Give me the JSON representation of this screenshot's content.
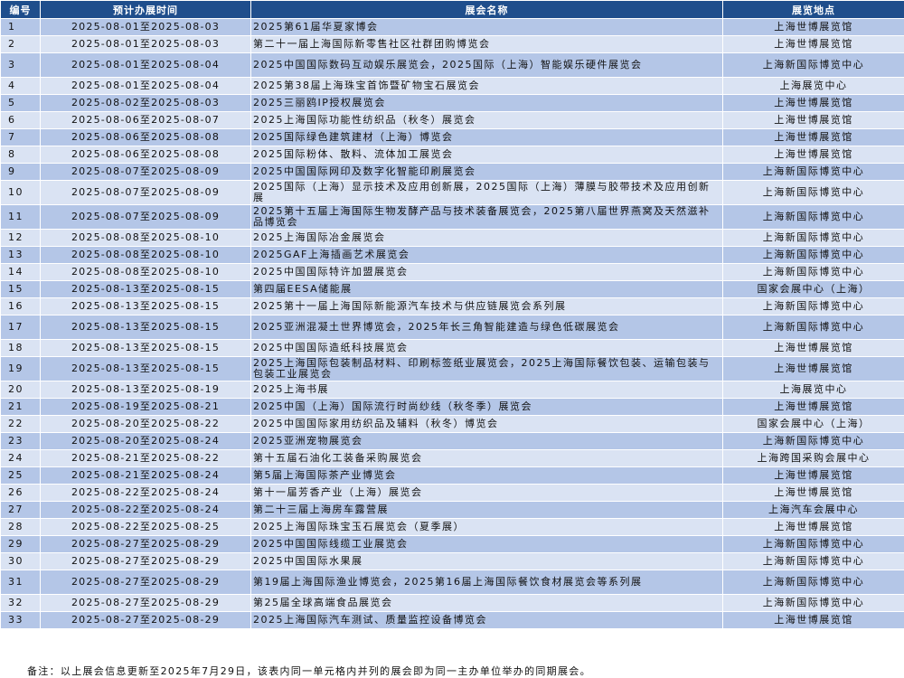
{
  "headers": {
    "no": "编号",
    "date": "预计办展时间",
    "name": "展会名称",
    "venue": "展览地点"
  },
  "rows": [
    {
      "no": "1",
      "date": "2025-08-01至2025-08-03",
      "name": "2025第61届华夏家博会",
      "venue": "上海世博展览馆"
    },
    {
      "no": "2",
      "date": "2025-08-01至2025-08-03",
      "name": "第二十一届上海国际新零售社区社群团购博览会",
      "venue": "上海世博展览馆"
    },
    {
      "no": "3",
      "date": "2025-08-01至2025-08-04",
      "name": "2025中国国际数码互动娱乐展览会，2025国际（上海）智能娱乐硬件展览会",
      "venue": "上海新国际博览中心"
    },
    {
      "no": "4",
      "date": "2025-08-01至2025-08-04",
      "name": "2025第38届上海珠宝首饰暨矿物宝石展览会",
      "venue": "上海展览中心"
    },
    {
      "no": "5",
      "date": "2025-08-02至2025-08-03",
      "name": "2025三丽鸥IP授权展览会",
      "venue": "上海世博展览馆"
    },
    {
      "no": "6",
      "date": "2025-08-06至2025-08-07",
      "name": "2025上海国际功能性纺织品（秋冬）展览会",
      "venue": "上海世博展览馆"
    },
    {
      "no": "7",
      "date": "2025-08-06至2025-08-08",
      "name": "2025国际绿色建筑建材（上海）博览会",
      "venue": "上海世博展览馆"
    },
    {
      "no": "8",
      "date": "2025-08-06至2025-08-08",
      "name": "2025国际粉体、散料、流体加工展览会",
      "venue": "上海世博展览馆"
    },
    {
      "no": "9",
      "date": "2025-08-07至2025-08-09",
      "name": "2025中国国际网印及数字化智能印刷展览会",
      "venue": "上海新国际博览中心"
    },
    {
      "no": "10",
      "date": "2025-08-07至2025-08-09",
      "name": "2025国际（上海）显示技术及应用创新展，2025国际（上海）薄膜与胶带技术及应用创新展",
      "venue": "上海新国际博览中心"
    },
    {
      "no": "11",
      "date": "2025-08-07至2025-08-09",
      "name": "2025第十五届上海国际生物发酵产品与技术装备展览会，2025第八届世界燕窝及天然滋补品博览会",
      "venue": "上海新国际博览中心"
    },
    {
      "no": "12",
      "date": "2025-08-08至2025-08-10",
      "name": "2025上海国际冶金展览会",
      "venue": "上海新国际博览中心"
    },
    {
      "no": "13",
      "date": "2025-08-08至2025-08-10",
      "name": "2025GAF上海插画艺术展览会",
      "venue": "上海新国际博览中心"
    },
    {
      "no": "14",
      "date": "2025-08-08至2025-08-10",
      "name": "2025中国国际特许加盟展览会",
      "venue": "上海新国际博览中心"
    },
    {
      "no": "15",
      "date": "2025-08-13至2025-08-15",
      "name": "第四届EESA储能展",
      "venue": "国家会展中心（上海）"
    },
    {
      "no": "16",
      "date": "2025-08-13至2025-08-15",
      "name": "2025第十一届上海国际新能源汽车技术与供应链展览会系列展",
      "venue": "上海新国际博览中心"
    },
    {
      "no": "17",
      "date": "2025-08-13至2025-08-15",
      "name": "2025亚洲混凝土世界博览会，2025年长三角智能建造与绿色低碳展览会",
      "venue": "上海新国际博览中心"
    },
    {
      "no": "18",
      "date": "2025-08-13至2025-08-15",
      "name": "2025中国国际造纸科技展览会",
      "venue": "上海世博展览馆"
    },
    {
      "no": "19",
      "date": "2025-08-13至2025-08-15",
      "name": "2025上海国际包装制品材料、印刷标签纸业展览会，2025上海国际餐饮包装、运输包装与包装工业展览会",
      "venue": "上海世博展览馆"
    },
    {
      "no": "20",
      "date": "2025-08-13至2025-08-19",
      "name": "2025上海书展",
      "venue": "上海展览中心"
    },
    {
      "no": "21",
      "date": "2025-08-19至2025-08-21",
      "name": "2025中国（上海）国际流行时尚纱线（秋冬季）展览会",
      "venue": "上海世博展览馆"
    },
    {
      "no": "22",
      "date": "2025-08-20至2025-08-22",
      "name": "2025中国国际家用纺织品及辅料（秋冬）博览会",
      "venue": "国家会展中心（上海）"
    },
    {
      "no": "23",
      "date": "2025-08-20至2025-08-24",
      "name": "2025亚洲宠物展览会",
      "venue": "上海新国际博览中心"
    },
    {
      "no": "24",
      "date": "2025-08-21至2025-08-22",
      "name": "第十五届石油化工装备采购展览会",
      "venue": "上海跨国采购会展中心"
    },
    {
      "no": "25",
      "date": "2025-08-21至2025-08-24",
      "name": "第5届上海国际茶产业博览会",
      "venue": "上海世博展览馆"
    },
    {
      "no": "26",
      "date": "2025-08-22至2025-08-24",
      "name": "第十一届芳香产业（上海）展览会",
      "venue": "上海世博展览馆"
    },
    {
      "no": "27",
      "date": "2025-08-22至2025-08-24",
      "name": "第二十三届上海房车露营展",
      "venue": "上海汽车会展中心"
    },
    {
      "no": "28",
      "date": "2025-08-22至2025-08-25",
      "name": "2025上海国际珠宝玉石展览会（夏季展）",
      "venue": "上海世博展览馆"
    },
    {
      "no": "29",
      "date": "2025-08-27至2025-08-29",
      "name": "2025中国国际线缆工业展览会",
      "venue": "上海新国际博览中心"
    },
    {
      "no": "30",
      "date": "2025-08-27至2025-08-29",
      "name": "2025中国国际水果展",
      "venue": "上海新国际博览中心"
    },
    {
      "no": "31",
      "date": "2025-08-27至2025-08-29",
      "name": "第19届上海国际渔业博览会，2025第16届上海国际餐饮食材展览会等系列展",
      "venue": "上海新国际博览中心"
    },
    {
      "no": "32",
      "date": "2025-08-27至2025-08-29",
      "name": "第25届全球高端食品展览会",
      "venue": "上海新国际博览中心"
    },
    {
      "no": "33",
      "date": "2025-08-27至2025-08-29",
      "name": "2025上海国际汽车测试、质量监控设备博览会",
      "venue": "上海世博展览馆"
    }
  ],
  "note": "备注：以上展会信息更新至2025年7月29日，该表内同一单元格内并列的展会即为同一主办单位举办的同期展会。"
}
